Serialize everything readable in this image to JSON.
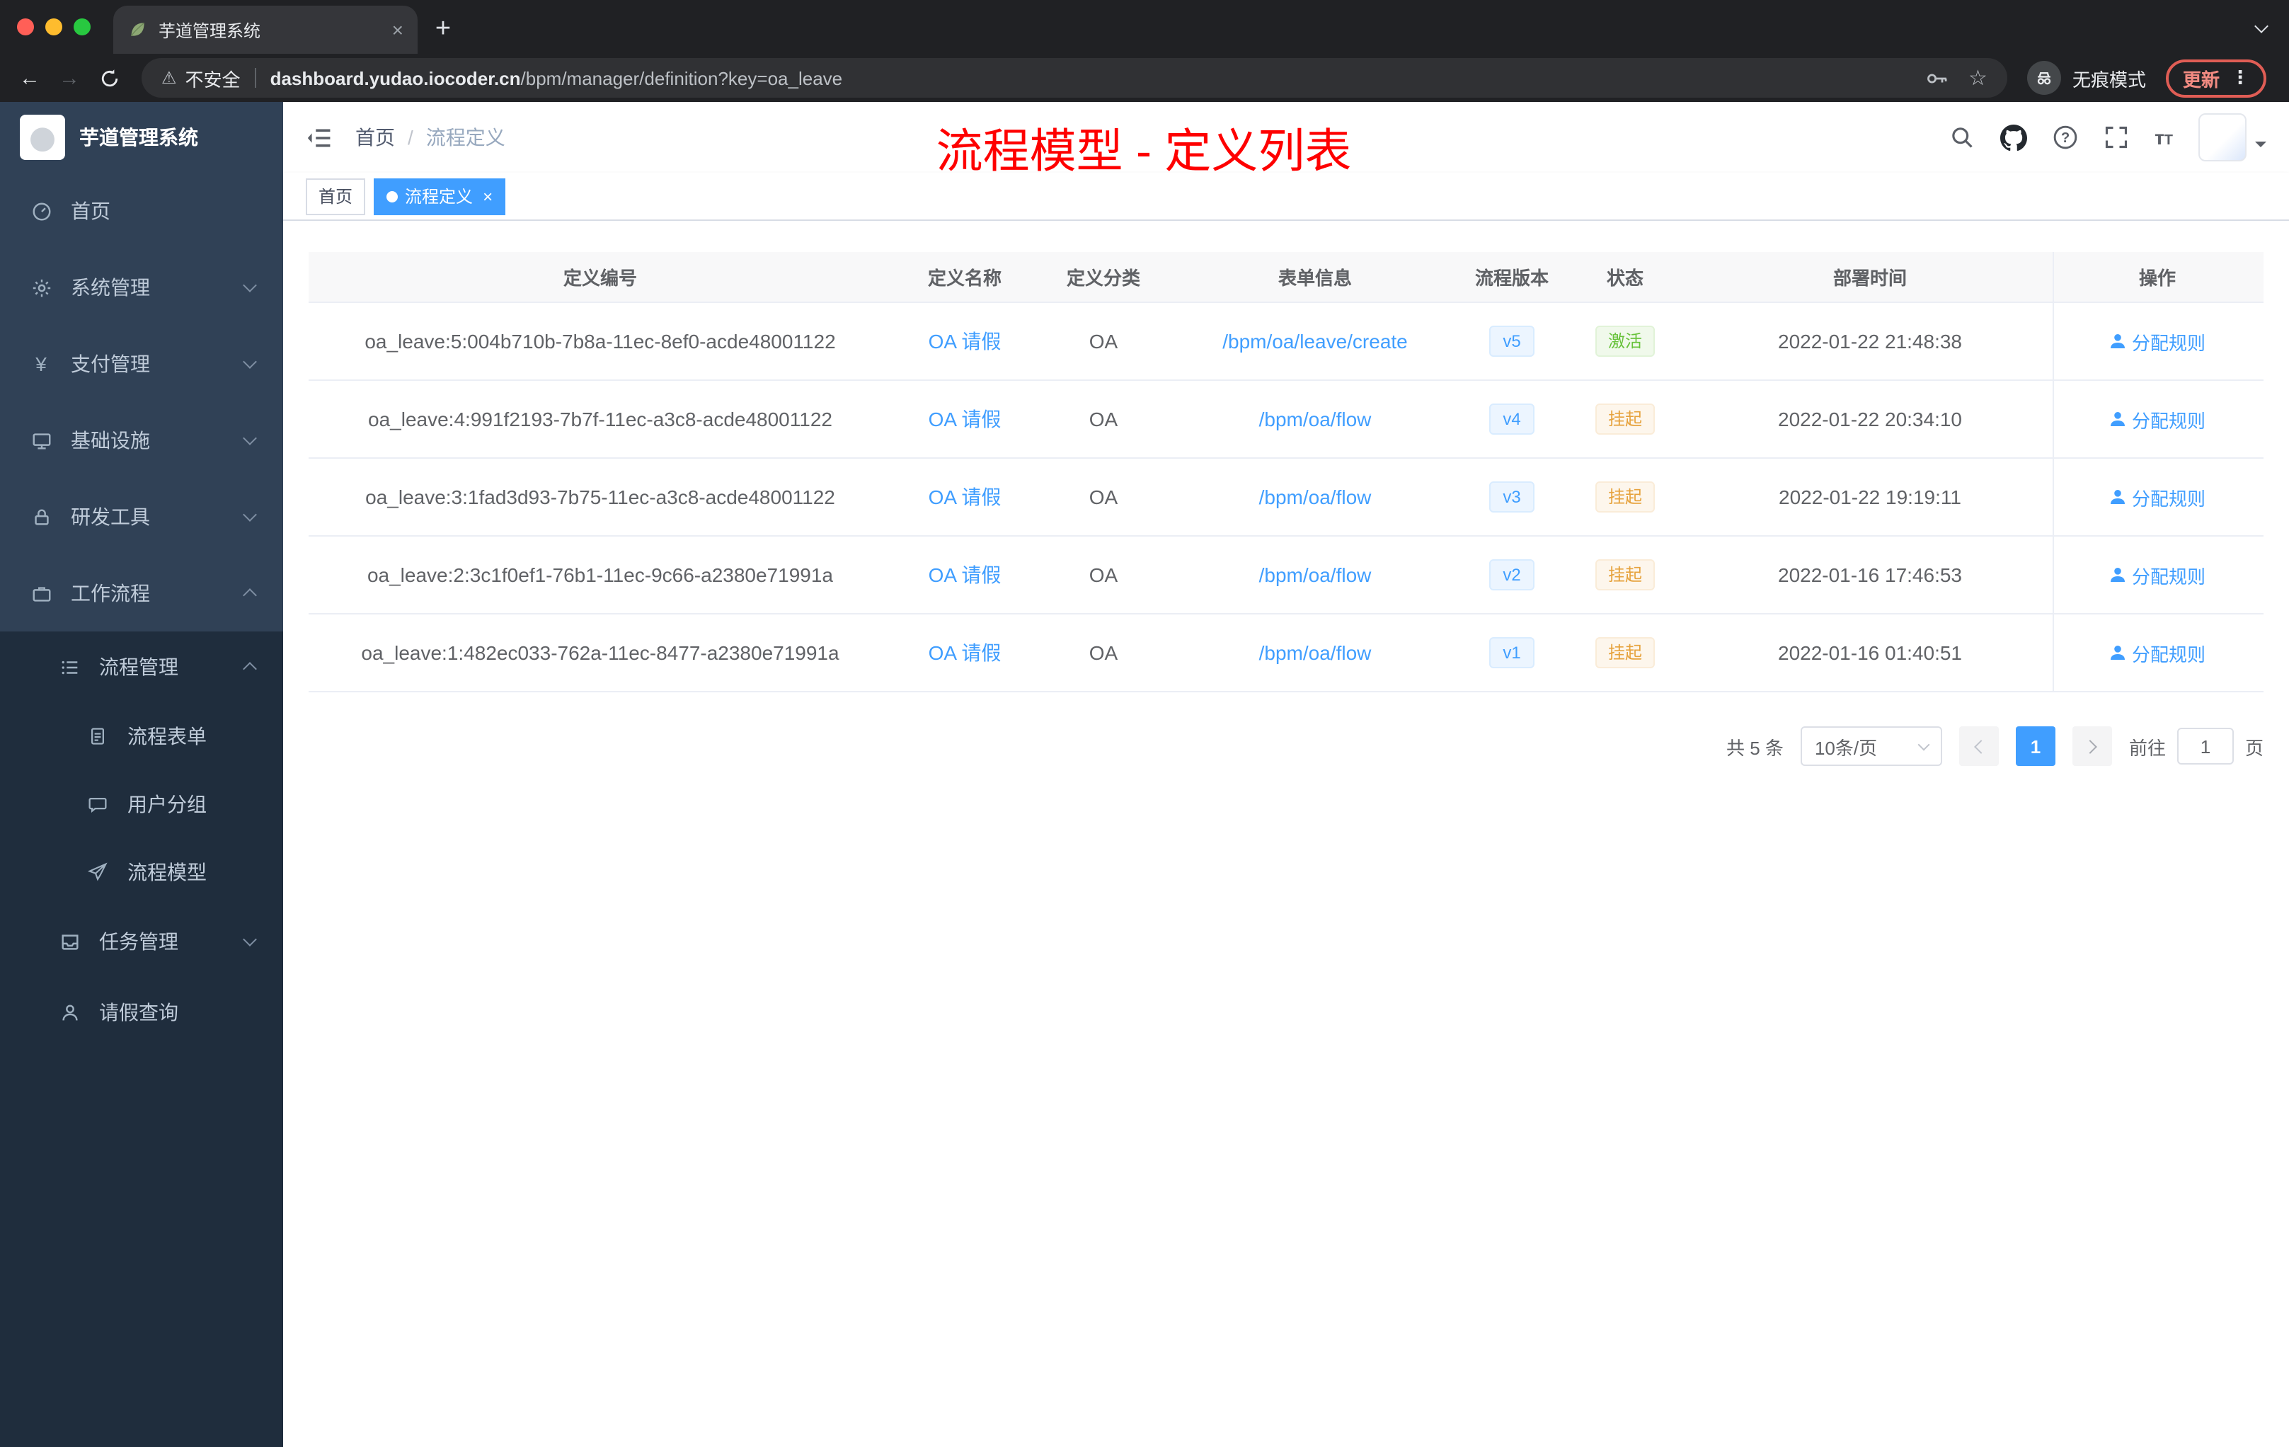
{
  "colors": {
    "accent": "#409eff",
    "success": "#67c23a",
    "warning": "#e6a23c",
    "annotation": "#fe0000"
  },
  "browser": {
    "tab_title": "芋道管理系统",
    "security_label": "不安全",
    "url_domain": "dashboard.yudao.iocoder.cn",
    "url_path": "/bpm/manager/definition?key=oa_leave",
    "incognito_label": "无痕模式",
    "update_label": "更新"
  },
  "sidebar": {
    "app_title": "芋道管理系统",
    "items": [
      {
        "label": "首页",
        "arrow": ""
      },
      {
        "label": "系统管理",
        "arrow": "down"
      },
      {
        "label": "支付管理",
        "arrow": "down"
      },
      {
        "label": "基础设施",
        "arrow": "down"
      },
      {
        "label": "研发工具",
        "arrow": "down"
      },
      {
        "label": "工作流程",
        "arrow": "up"
      }
    ],
    "submenu": {
      "process_mgmt": "流程管理",
      "process_mgmt_arrow": "up",
      "children": [
        "流程表单",
        "用户分组",
        "流程模型"
      ],
      "task_mgmt": "任务管理",
      "task_mgmt_arrow": "down",
      "leave_query": "请假查询"
    }
  },
  "header": {
    "breadcrumb_home": "首页",
    "breadcrumb_sep": "/",
    "breadcrumb_current": "流程定义"
  },
  "annotation": "流程模型 - 定义列表",
  "tags": {
    "home": "首页",
    "active": "流程定义"
  },
  "table": {
    "columns": [
      "定义编号",
      "定义名称",
      "定义分类",
      "表单信息",
      "流程版本",
      "状态",
      "部署时间",
      "操作"
    ],
    "rows": [
      {
        "id": "oa_leave:5:004b710b-7b8a-11ec-8ef0-acde48001122",
        "name": "OA 请假",
        "category": "OA",
        "form": "/bpm/oa/leave/create",
        "version": "v5",
        "status": "激活",
        "status_type": "success",
        "deploy_time": "2022-01-22 21:48:38",
        "action": "分配规则"
      },
      {
        "id": "oa_leave:4:991f2193-7b7f-11ec-a3c8-acde48001122",
        "name": "OA 请假",
        "category": "OA",
        "form": "/bpm/oa/flow",
        "version": "v4",
        "status": "挂起",
        "status_type": "warning",
        "deploy_time": "2022-01-22 20:34:10",
        "action": "分配规则"
      },
      {
        "id": "oa_leave:3:1fad3d93-7b75-11ec-a3c8-acde48001122",
        "name": "OA 请假",
        "category": "OA",
        "form": "/bpm/oa/flow",
        "version": "v3",
        "status": "挂起",
        "status_type": "warning",
        "deploy_time": "2022-01-22 19:19:11",
        "action": "分配规则"
      },
      {
        "id": "oa_leave:2:3c1f0ef1-76b1-11ec-9c66-a2380e71991a",
        "name": "OA 请假",
        "category": "OA",
        "form": "/bpm/oa/flow",
        "version": "v2",
        "status": "挂起",
        "status_type": "warning",
        "deploy_time": "2022-01-16 17:46:53",
        "action": "分配规则"
      },
      {
        "id": "oa_leave:1:482ec033-762a-11ec-8477-a2380e71991a",
        "name": "OA 请假",
        "category": "OA",
        "form": "/bpm/oa/flow",
        "version": "v1",
        "status": "挂起",
        "status_type": "warning",
        "deploy_time": "2022-01-16 01:40:51",
        "action": "分配规则"
      }
    ]
  },
  "pagination": {
    "total": "共 5 条",
    "page_size": "10条/页",
    "current_page": "1",
    "jump_prefix": "前往",
    "jump_value": "1",
    "jump_suffix": "页"
  }
}
